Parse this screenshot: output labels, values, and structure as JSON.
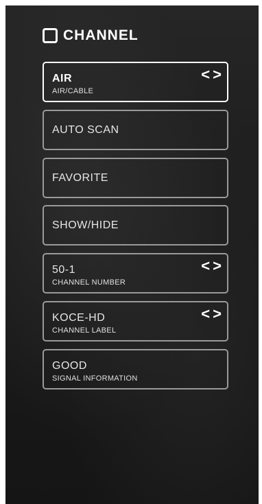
{
  "header": {
    "title": "CHANNEL",
    "icon": "channel-square-icon"
  },
  "arrows": {
    "left": "<",
    "right": ">"
  },
  "items": [
    {
      "main": "AIR",
      "sub": "AIR/CABLE",
      "selected": true,
      "arrows": true
    },
    {
      "main": "AUTO SCAN",
      "sub": "",
      "selected": false,
      "arrows": false
    },
    {
      "main": "FAVORITE",
      "sub": "",
      "selected": false,
      "arrows": false
    },
    {
      "main": "SHOW/HIDE",
      "sub": "",
      "selected": false,
      "arrows": false
    },
    {
      "main": "50-1",
      "sub": "CHANNEL NUMBER",
      "selected": false,
      "arrows": true
    },
    {
      "main": "KOCE-HD",
      "sub": "CHANNEL LABEL",
      "selected": false,
      "arrows": true
    },
    {
      "main": "GOOD",
      "sub": "SIGNAL INFORMATION",
      "selected": false,
      "arrows": false
    }
  ],
  "colors": {
    "background": "#1c1c1c",
    "border": "#9a9a9a",
    "selected_border": "#ffffff",
    "text": "#e6e6e6"
  }
}
